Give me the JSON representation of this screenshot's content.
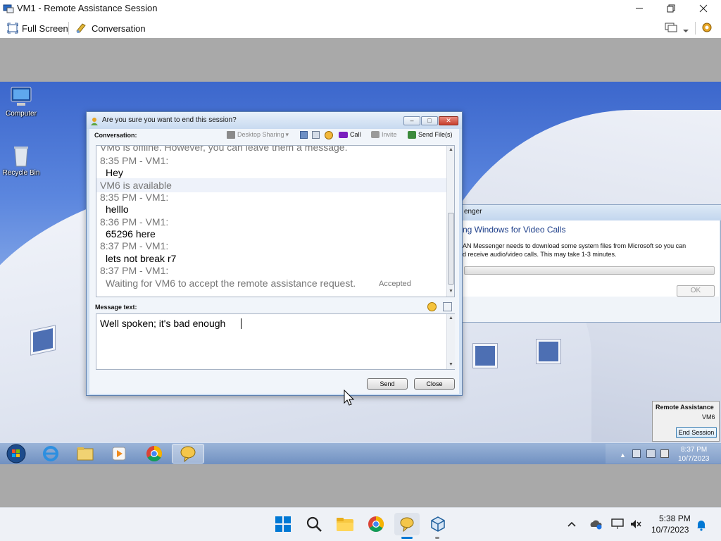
{
  "host_window": {
    "title": "VM1 - Remote Assistance Session",
    "toolbar": {
      "full_screen": "Full Screen",
      "conversation": "Conversation"
    }
  },
  "desktop": {
    "icons": [
      {
        "label": "Computer"
      },
      {
        "label": "Recycle Bin"
      }
    ]
  },
  "chat_window": {
    "title": "Are you sure you want to end this session?",
    "conversation_label": "Conversation:",
    "toolbar": {
      "desktop_sharing": "Desktop Sharing",
      "call": "Call",
      "invite": "Invite",
      "send_files": "Send File(s)"
    },
    "messages": [
      {
        "type": "meta",
        "text": "VM6 is offline. However, you can leave them a message."
      },
      {
        "type": "meta",
        "text": "8:35 PM - VM1:"
      },
      {
        "type": "body",
        "text": "Hey"
      },
      {
        "type": "meta",
        "text": "VM6 is available"
      },
      {
        "type": "meta",
        "text": "8:35 PM - VM1:"
      },
      {
        "type": "body",
        "text": "helllo"
      },
      {
        "type": "meta",
        "text": "8:36 PM - VM1:"
      },
      {
        "type": "body",
        "text": "65296 here"
      },
      {
        "type": "meta",
        "text": "8:37 PM - VM1:"
      },
      {
        "type": "body",
        "text": "lets not break r7"
      },
      {
        "type": "meta",
        "text": "8:37 PM - VM1:"
      },
      {
        "type": "meta",
        "text": "Waiting for VM6 to accept the remote assistance request."
      }
    ],
    "accepted_label": "Accepted",
    "message_label": "Message text:",
    "message_value": "Well spoken; it's bad enough",
    "send_button": "Send",
    "close_button": "Close"
  },
  "background_dialog": {
    "title_fragment": "enger",
    "heading_fragment": "ng Windows for Video Calls",
    "body_line1": "AN Messenger needs to download some system files from Microsoft so you can",
    "body_line2": "d receive audio/video calls. This may take 1-3 minutes.",
    "ok_button": "OK"
  },
  "remote_assistance_panel": {
    "title": "Remote Assistance",
    "user": "VM6",
    "end_session_button": "End Session"
  },
  "remote_taskbar": {
    "time": "8:37 PM",
    "date": "10/7/2023"
  },
  "host_taskbar": {
    "time": "5:38 PM",
    "date": "10/7/2023"
  },
  "colors": {
    "accent": "#0078d4",
    "chat_frame": "#cfe0f3"
  }
}
